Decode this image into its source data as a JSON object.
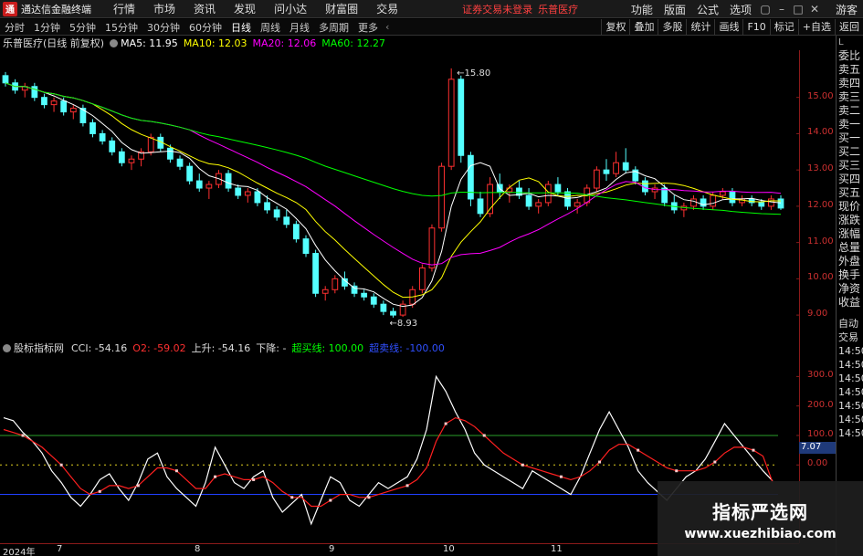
{
  "titlebar": {
    "app_title": "通达信金融终端",
    "logo_glyph": "通",
    "menu": [
      "行情",
      "市场",
      "资讯",
      "发现",
      "问小达",
      "财富圈",
      "交易"
    ],
    "login_status": "证券交易未登录",
    "stock_name": "乐普医疗",
    "right_menu": [
      "功能",
      "版面",
      "公式",
      "选项"
    ],
    "guest": "游客"
  },
  "periodbar": {
    "periods": [
      "分时",
      "1分钟",
      "5分钟",
      "15分钟",
      "30分钟",
      "60分钟",
      "日线",
      "周线",
      "月线",
      "多周期",
      "更多"
    ],
    "active": "日线",
    "arrow": "‹",
    "tools": [
      "复权",
      "叠加",
      "多股",
      "统计",
      "画线",
      "F10",
      "标记",
      "+自选",
      "返回"
    ]
  },
  "infobar": {
    "stock_title": "乐普医疗(日线 前复权)",
    "ma5": "MA5: 11.95",
    "ma10": "MA10: 12.03",
    "ma20": "MA20: 12.06",
    "ma60": "MA60: 12.27",
    "colors": {
      "ma5": "#ffffff",
      "ma10": "#ffff00",
      "ma20": "#ff00ff",
      "ma60": "#00ff00"
    }
  },
  "indicator": {
    "name": "股标指标网",
    "cci": "CCI: -54.16",
    "o2": "O2: -59.02",
    "up": "上升: -54.16",
    "down": "下降: -",
    "overbuy": "超买线: 100.00",
    "oversell": "超卖线: -100.00"
  },
  "main_axis": [
    "15.00",
    "14.00",
    "13.00",
    "12.00",
    "11.00",
    "10.00",
    "9.00"
  ],
  "ind_axis": [
    "300.0",
    "200.0",
    "100.0",
    "0.00"
  ],
  "date_value": "7.07",
  "annotations": {
    "high": "15.80",
    "low": "8.93"
  },
  "xaxis": [
    "2024年",
    "7",
    "8",
    "9",
    "10",
    "11"
  ],
  "order_panel": [
    "委比",
    "卖五",
    "卖四",
    "卖三",
    "卖二",
    "卖一",
    "买一",
    "买二",
    "买三",
    "买四",
    "买五",
    "现价",
    "涨跌",
    "涨幅",
    "总量",
    "外盘",
    "换手",
    "净资",
    "收益"
  ],
  "order_panel_bottom": [
    "自动",
    "交易",
    "14:50",
    "14:50",
    "14:50",
    "14:50",
    "14:50",
    "14:50",
    "14:50"
  ],
  "order_panel_top": "L",
  "watermark": {
    "title": "指标严选网",
    "url": "www.xuezhibiao.com"
  },
  "chart_data": [
    {
      "type": "candlestick",
      "title": "乐普医疗(日线 前复权)",
      "ylim": [
        8.6,
        16.2
      ],
      "yticks": [
        9,
        10,
        11,
        12,
        13,
        14,
        15
      ],
      "series": [
        {
          "name": "MA5",
          "color": "#ffffff"
        },
        {
          "name": "MA10",
          "color": "#ffff00"
        },
        {
          "name": "MA20",
          "color": "#ff00ff"
        },
        {
          "name": "MA60",
          "color": "#00ff00"
        }
      ],
      "ohlc": [
        [
          15.6,
          15.7,
          15.3,
          15.4
        ],
        [
          15.4,
          15.5,
          15.1,
          15.2
        ],
        [
          15.2,
          15.4,
          15.0,
          15.3
        ],
        [
          15.3,
          15.4,
          14.9,
          15.0
        ],
        [
          15.0,
          15.1,
          14.7,
          14.8
        ],
        [
          14.8,
          15.0,
          14.6,
          14.9
        ],
        [
          14.9,
          15.0,
          14.5,
          14.6
        ],
        [
          14.6,
          14.8,
          14.4,
          14.7
        ],
        [
          14.7,
          14.8,
          14.2,
          14.3
        ],
        [
          14.3,
          14.4,
          13.9,
          14.0
        ],
        [
          14.0,
          14.1,
          13.7,
          13.8
        ],
        [
          13.8,
          13.9,
          13.4,
          13.5
        ],
        [
          13.5,
          13.6,
          13.1,
          13.2
        ],
        [
          13.2,
          13.4,
          13.0,
          13.3
        ],
        [
          13.3,
          13.6,
          13.1,
          13.5
        ],
        [
          13.5,
          14.0,
          13.4,
          13.9
        ],
        [
          13.9,
          14.0,
          13.5,
          13.6
        ],
        [
          13.6,
          13.7,
          13.2,
          13.3
        ],
        [
          13.3,
          13.4,
          13.0,
          13.1
        ],
        [
          13.1,
          13.2,
          12.6,
          12.7
        ],
        [
          12.7,
          12.9,
          12.4,
          12.5
        ],
        [
          12.5,
          12.7,
          12.2,
          12.6
        ],
        [
          12.6,
          13.0,
          12.5,
          12.9
        ],
        [
          12.9,
          13.0,
          12.4,
          12.5
        ],
        [
          12.5,
          12.6,
          12.2,
          12.3
        ],
        [
          12.3,
          12.5,
          12.1,
          12.4
        ],
        [
          12.4,
          12.5,
          12.0,
          12.1
        ],
        [
          12.1,
          12.3,
          11.8,
          11.9
        ],
        [
          11.9,
          12.0,
          11.6,
          11.7
        ],
        [
          11.7,
          11.9,
          11.4,
          11.5
        ],
        [
          11.5,
          11.6,
          11.0,
          11.1
        ],
        [
          11.1,
          11.2,
          10.6,
          10.7
        ],
        [
          10.7,
          10.8,
          9.5,
          9.6
        ],
        [
          9.6,
          9.8,
          9.4,
          9.7
        ],
        [
          9.7,
          10.1,
          9.6,
          10.0
        ],
        [
          10.0,
          10.2,
          9.7,
          9.8
        ],
        [
          9.8,
          9.9,
          9.5,
          9.6
        ],
        [
          9.6,
          9.7,
          9.4,
          9.5
        ],
        [
          9.5,
          9.6,
          9.2,
          9.3
        ],
        [
          9.3,
          9.4,
          9.0,
          9.1
        ],
        [
          9.1,
          9.2,
          8.93,
          9.0
        ],
        [
          9.0,
          9.4,
          8.95,
          9.3
        ],
        [
          9.3,
          9.8,
          9.2,
          9.7
        ],
        [
          9.7,
          10.4,
          9.6,
          10.3
        ],
        [
          10.3,
          11.5,
          10.2,
          11.4
        ],
        [
          11.4,
          13.2,
          11.3,
          13.1
        ],
        [
          13.1,
          15.8,
          13.0,
          15.5
        ],
        [
          15.5,
          15.6,
          13.2,
          13.4
        ],
        [
          13.4,
          13.5,
          12.0,
          12.2
        ],
        [
          12.2,
          12.4,
          11.7,
          11.8
        ],
        [
          11.8,
          12.8,
          11.7,
          12.6
        ],
        [
          12.6,
          12.9,
          12.2,
          12.4
        ],
        [
          12.4,
          12.6,
          12.1,
          12.5
        ],
        [
          12.5,
          12.7,
          12.2,
          12.3
        ],
        [
          12.3,
          12.5,
          11.9,
          12.0
        ],
        [
          12.0,
          12.2,
          11.8,
          12.1
        ],
        [
          12.1,
          12.7,
          12.0,
          12.6
        ],
        [
          12.6,
          12.8,
          12.3,
          12.4
        ],
        [
          12.4,
          12.5,
          11.9,
          12.0
        ],
        [
          12.0,
          12.2,
          11.8,
          12.1
        ],
        [
          12.1,
          12.6,
          12.0,
          12.5
        ],
        [
          12.5,
          13.1,
          12.4,
          13.0
        ],
        [
          13.0,
          13.3,
          12.7,
          12.9
        ],
        [
          12.9,
          13.5,
          12.8,
          13.2
        ],
        [
          13.2,
          13.6,
          12.9,
          13.0
        ],
        [
          13.0,
          13.1,
          12.6,
          12.7
        ],
        [
          12.7,
          12.8,
          12.3,
          12.4
        ],
        [
          12.4,
          12.6,
          12.2,
          12.5
        ],
        [
          12.5,
          12.6,
          12.0,
          12.1
        ],
        [
          12.1,
          12.3,
          11.8,
          11.9
        ],
        [
          11.9,
          12.1,
          11.7,
          12.0
        ],
        [
          12.0,
          12.3,
          11.9,
          12.2
        ],
        [
          12.2,
          12.3,
          11.9,
          12.0
        ],
        [
          12.0,
          12.4,
          11.9,
          12.3
        ],
        [
          12.3,
          12.5,
          12.2,
          12.4
        ],
        [
          12.4,
          12.5,
          12.0,
          12.1
        ],
        [
          12.1,
          12.3,
          12.0,
          12.2
        ],
        [
          12.2,
          12.3,
          12.0,
          12.1
        ],
        [
          12.1,
          12.2,
          11.9,
          12.0
        ],
        [
          12.0,
          12.3,
          11.9,
          12.2
        ],
        [
          12.2,
          12.3,
          11.9,
          11.95
        ]
      ]
    },
    {
      "type": "line",
      "title": "CCI",
      "ylim": [
        -250,
        360
      ],
      "yticks": [
        0,
        100,
        200,
        300
      ],
      "series": [
        {
          "name": "CCI",
          "color": "#ffffff",
          "values": [
            160,
            150,
            110,
            80,
            40,
            -20,
            -60,
            -110,
            -140,
            -100,
            -50,
            -30,
            -80,
            -120,
            -60,
            20,
            40,
            -40,
            -80,
            -110,
            -140,
            -60,
            60,
            0,
            -60,
            -80,
            -40,
            -20,
            -110,
            -160,
            -130,
            -100,
            -200,
            -120,
            -40,
            -60,
            -120,
            -140,
            -100,
            -60,
            -80,
            -60,
            -40,
            20,
            120,
            300,
            250,
            180,
            120,
            40,
            0,
            -20,
            -40,
            -60,
            -80,
            -20,
            -40,
            -60,
            -80,
            -100,
            -40,
            40,
            120,
            180,
            120,
            60,
            -20,
            -60,
            -90,
            -120,
            -80,
            -40,
            -20,
            20,
            80,
            140,
            100,
            60,
            20,
            -20,
            -54
          ]
        },
        {
          "name": "O2",
          "color": "#ff2020",
          "values": [
            120,
            110,
            100,
            80,
            60,
            30,
            0,
            -40,
            -80,
            -100,
            -90,
            -70,
            -70,
            -80,
            -70,
            -40,
            -10,
            -10,
            -20,
            -50,
            -80,
            -80,
            -40,
            -30,
            -40,
            -50,
            -50,
            -40,
            -60,
            -90,
            -110,
            -110,
            -140,
            -140,
            -120,
            -100,
            -100,
            -110,
            -110,
            -100,
            -90,
            -80,
            -70,
            -50,
            -10,
            80,
            140,
            160,
            150,
            130,
            100,
            70,
            40,
            20,
            0,
            -10,
            -20,
            -30,
            -40,
            -50,
            -40,
            -20,
            10,
            50,
            70,
            70,
            50,
            30,
            10,
            -10,
            -20,
            -20,
            -20,
            -10,
            10,
            40,
            60,
            60,
            50,
            30,
            -59
          ]
        }
      ],
      "reference_lines": [
        100,
        -100,
        0
      ]
    }
  ]
}
